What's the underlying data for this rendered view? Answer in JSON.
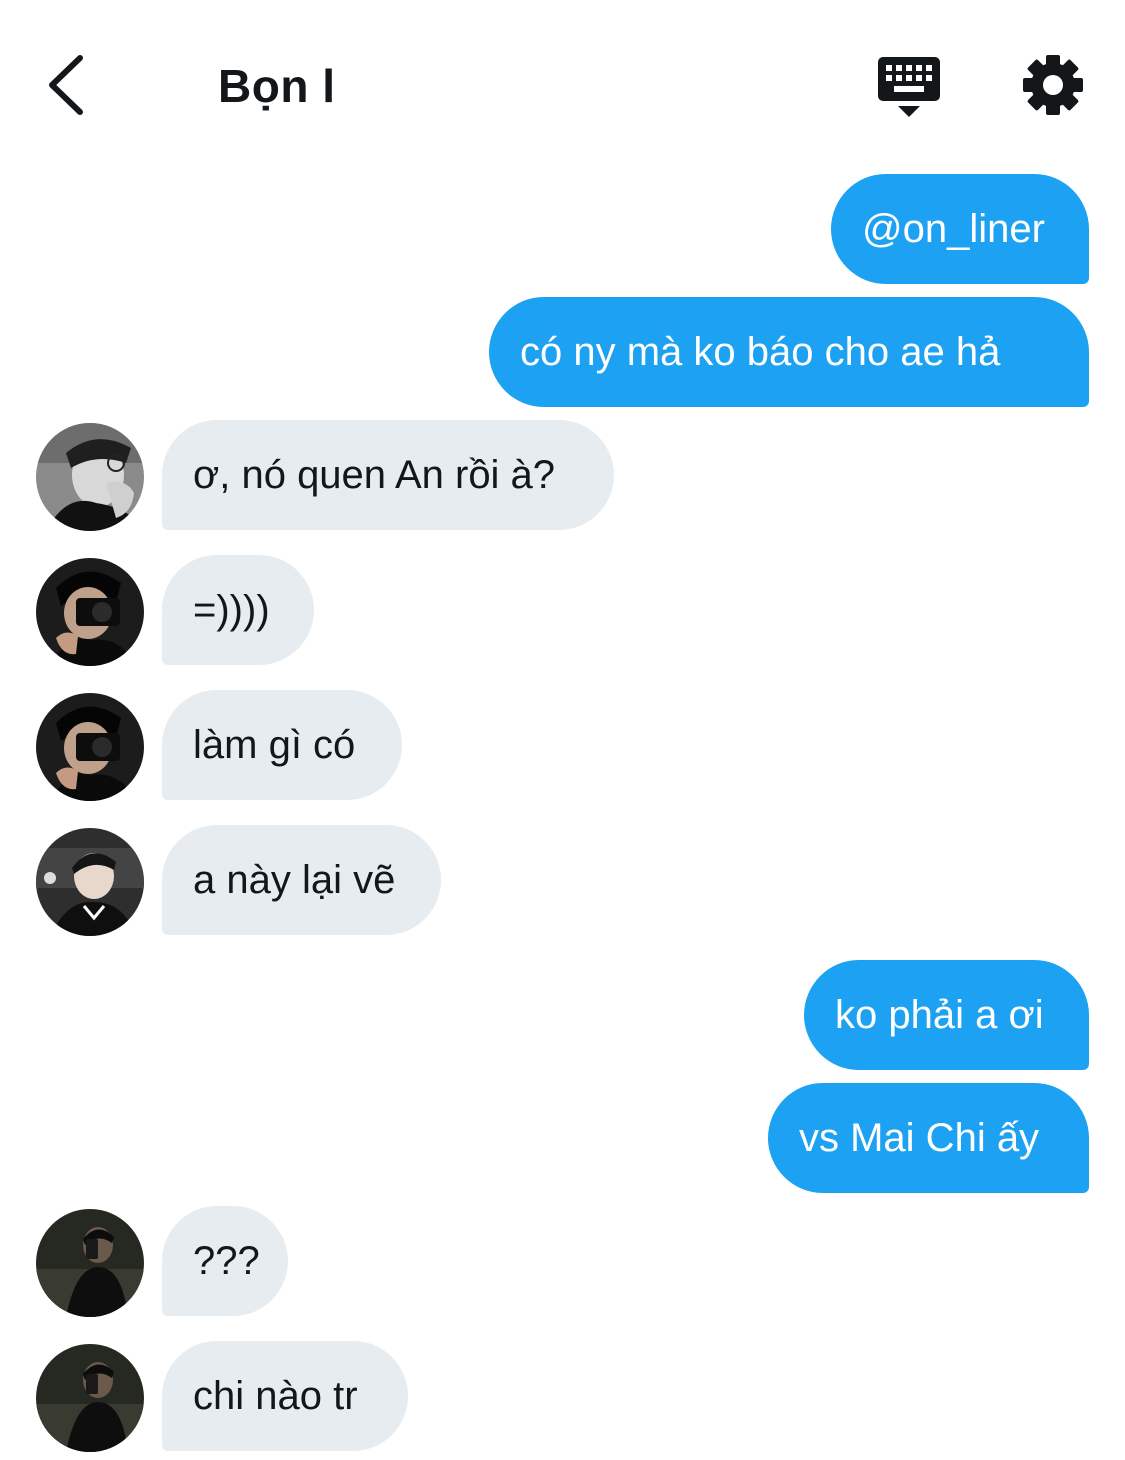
{
  "header": {
    "title": "Bọn l",
    "back_icon": "chevron-left-icon",
    "keyboard_icon": "keyboard-icon",
    "settings_icon": "gear-icon"
  },
  "colors": {
    "outgoing_bubble": "#1da1f2",
    "incoming_bubble": "#e6ecf0",
    "text": "#14171a"
  },
  "messages": [
    {
      "direction": "out",
      "text": "@on_liner"
    },
    {
      "direction": "out",
      "text": "có ny mà ko báo cho ae hả"
    },
    {
      "direction": "in",
      "avatar": "avatar-glasses",
      "text": "ơ, nó quen An rồi à?"
    },
    {
      "direction": "in",
      "avatar": "avatar-camera",
      "text": "=))))"
    },
    {
      "direction": "in",
      "avatar": "avatar-camera",
      "text": "làm gì có"
    },
    {
      "direction": "in",
      "avatar": "avatar-esports",
      "text": "a này lại vẽ"
    },
    {
      "direction": "out",
      "text": "ko phải a ơi"
    },
    {
      "direction": "out",
      "text": "vs Mai Chi ấy"
    },
    {
      "direction": "in",
      "avatar": "avatar-dark-selfie",
      "text": "???"
    },
    {
      "direction": "in",
      "avatar": "avatar-dark-selfie",
      "text": "chi nào tr"
    }
  ]
}
